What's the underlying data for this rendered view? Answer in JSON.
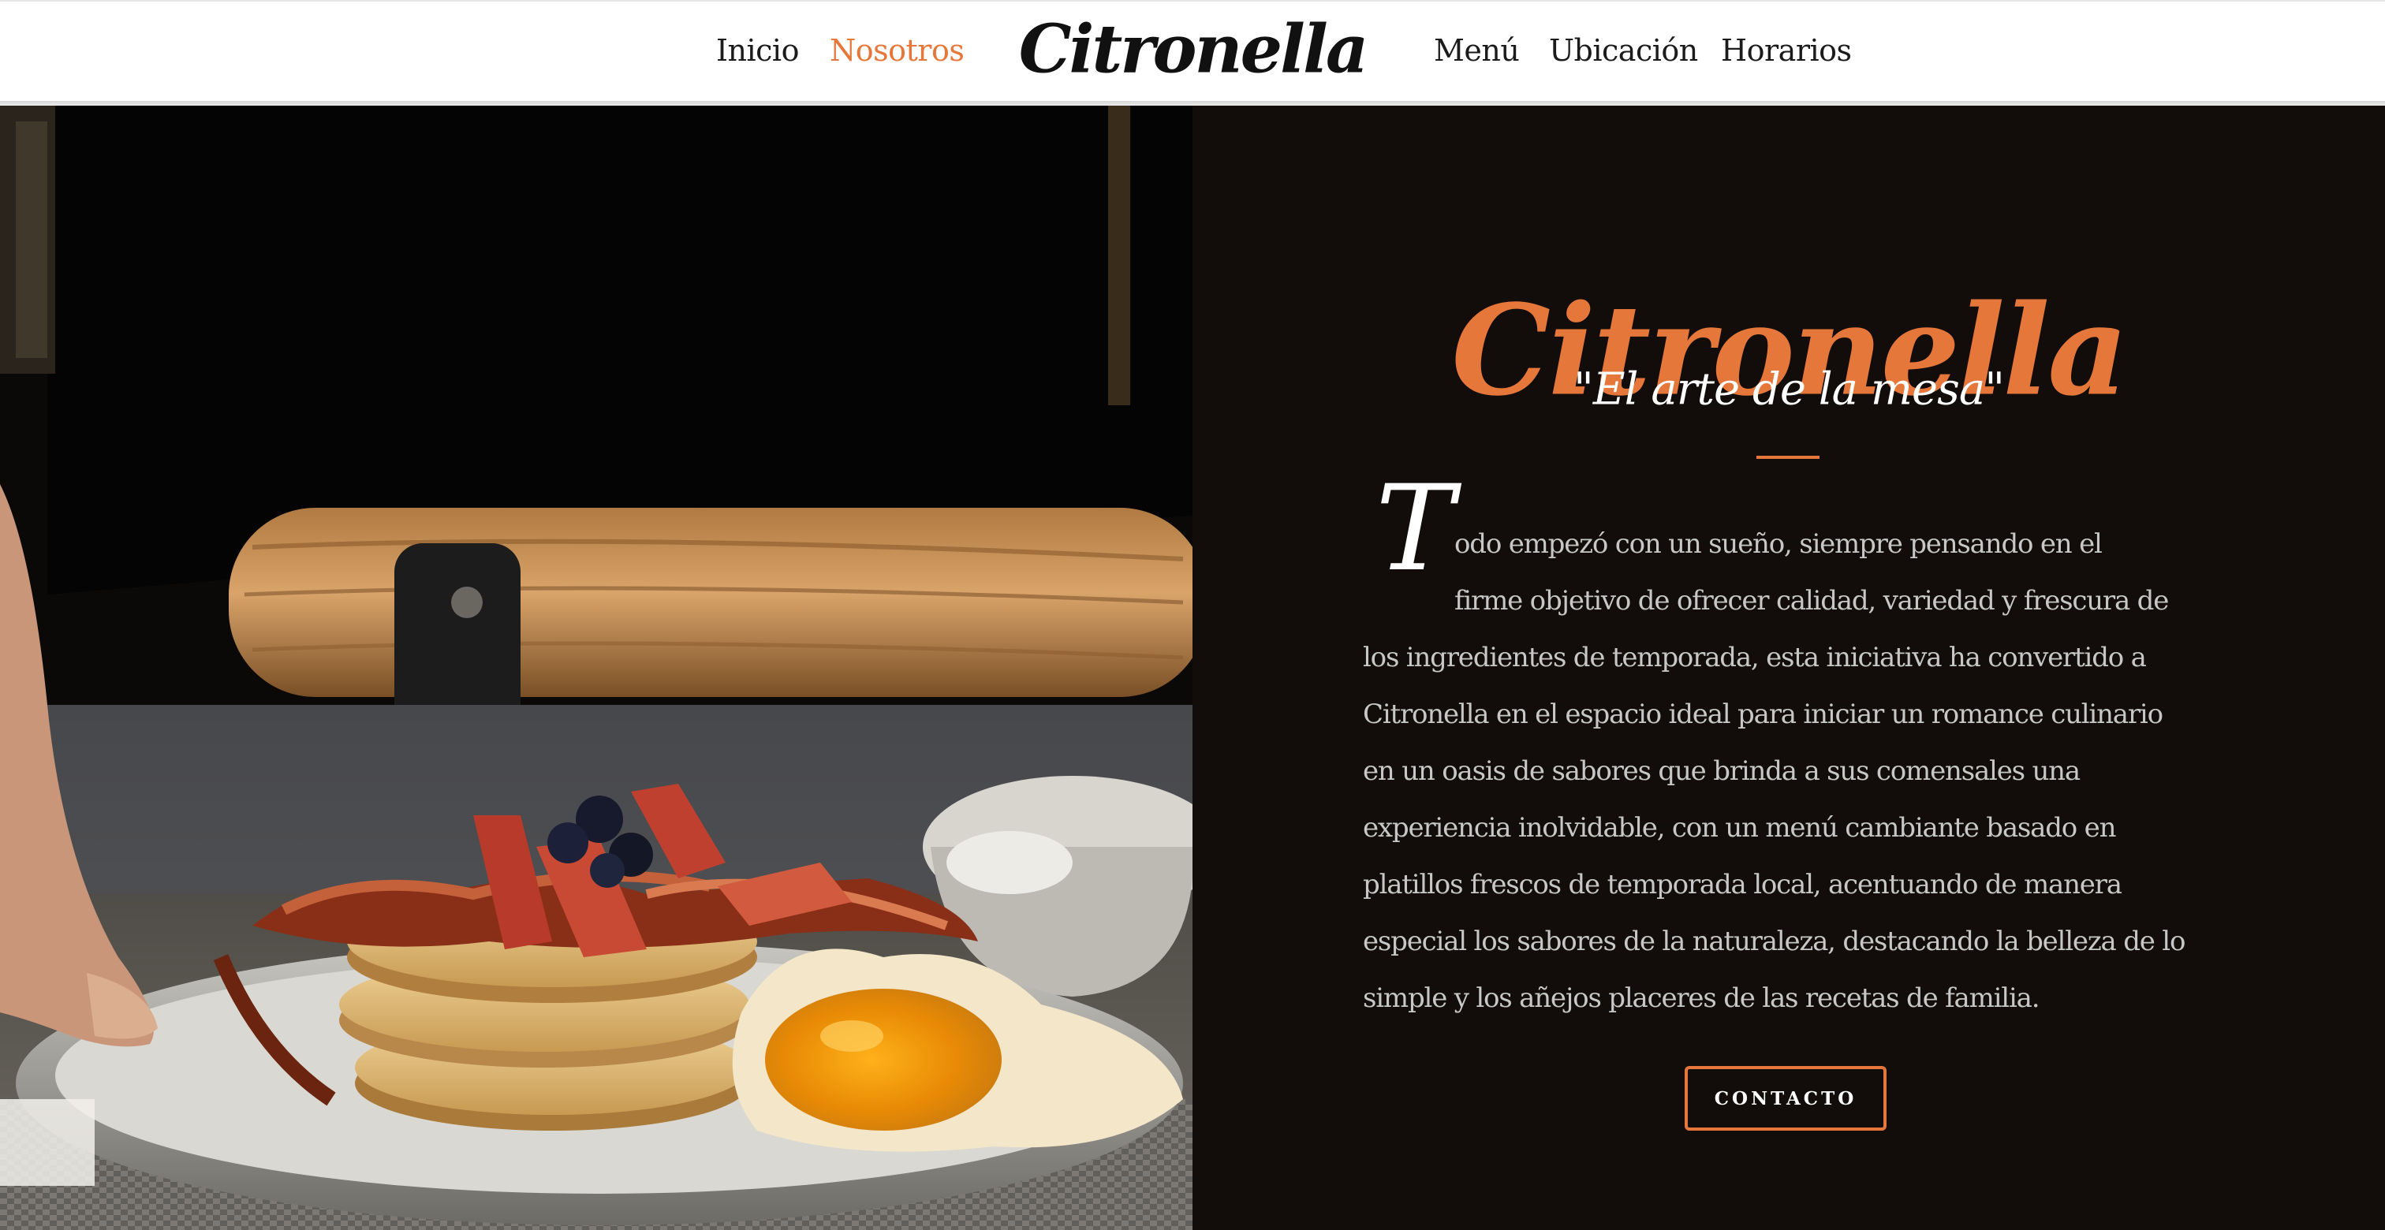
{
  "nav": {
    "links_left": [
      {
        "label": "Inicio",
        "active": false
      },
      {
        "label": "Nosotros",
        "active": true
      }
    ],
    "brand": "Citronella",
    "links_right": [
      {
        "label": "Menú",
        "active": false
      },
      {
        "label": "Ubicación",
        "active": false
      },
      {
        "label": "Horarios",
        "active": false
      }
    ]
  },
  "hero": {
    "image_subject": "plate of pancakes with bacon, strawberries, blueberries and fried egg on a table",
    "title": "Citronella",
    "tagline": "\"El arte de la mesa\"",
    "dropcap": "T",
    "body_lines": [
      "odo empezó con un sueño, siempre pensando en el",
      "firme objetivo de ofrecer calidad, variedad y frescura de",
      "los ingredientes de temporada, esta iniciativa ha convertido a",
      "Citronella en el espacio ideal para iniciar un romance culinario",
      "en un oasis de sabores que brinda a sus comensales una",
      "experiencia inolvidable, con un menú cambiante basado en",
      "platillos frescos de temporada local, acentuando de manera",
      "especial los sabores de la naturaleza, destacando la belleza de lo",
      "simple y los añejos placeres de las recetas de familia."
    ],
    "button_label": "CONTACTO"
  },
  "colors": {
    "accent": "#e6773a",
    "panel_background": "#120d0a",
    "body_text": "#c7c7c7",
    "nav_text": "#1b1b1b"
  }
}
